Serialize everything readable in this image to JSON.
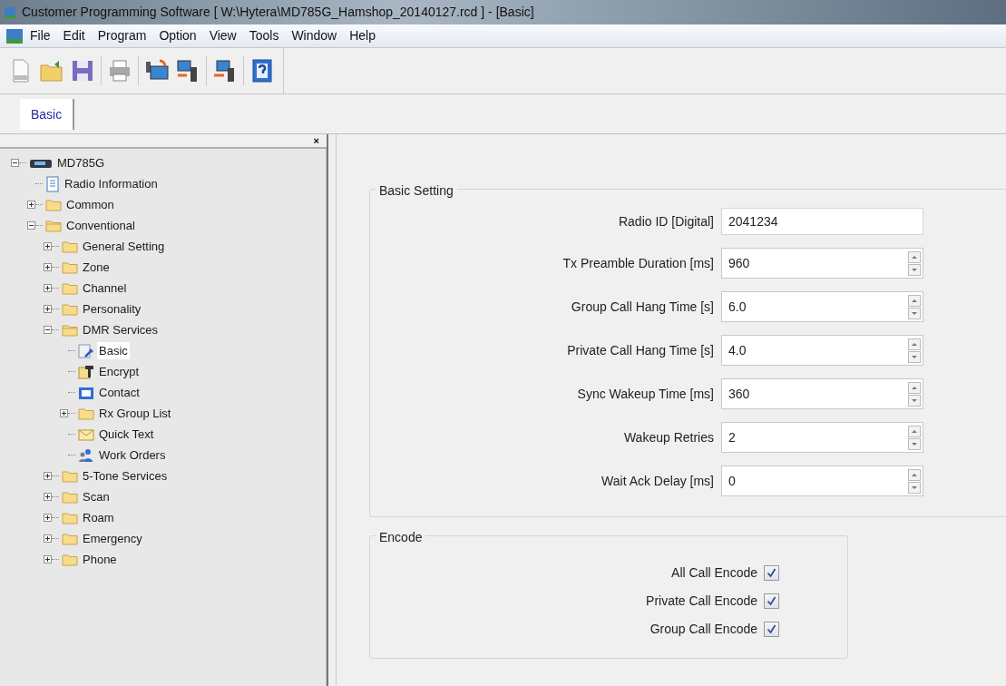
{
  "window": {
    "title": "Customer Programming Software [ W:\\Hytera\\MD785G_Hamshop_20140127.rcd ] - [Basic]"
  },
  "menu": [
    "File",
    "Edit",
    "Program",
    "Option",
    "View",
    "Tools",
    "Window",
    "Help"
  ],
  "tabs": [
    {
      "label": "Basic",
      "selected": true
    }
  ],
  "tree_pane": {
    "close": "×"
  },
  "tree": [
    {
      "label": "MD785G",
      "kind": "device",
      "expanded": true,
      "children": [
        {
          "label": "Radio Information",
          "kind": "document"
        },
        {
          "label": "Common",
          "kind": "folder",
          "expanded": false
        },
        {
          "label": "Conventional",
          "kind": "folder",
          "expanded": true,
          "children": [
            {
              "label": "General Setting",
              "kind": "folder",
              "expanded": false
            },
            {
              "label": "Zone",
              "kind": "folder",
              "expanded": false
            },
            {
              "label": "Channel",
              "kind": "folder",
              "expanded": false
            },
            {
              "label": "Personality",
              "kind": "folder",
              "expanded": false
            },
            {
              "label": "DMR Services",
              "kind": "folder",
              "expanded": true,
              "children": [
                {
                  "label": "Basic",
                  "kind": "settings",
                  "selected": true
                },
                {
                  "label": "Encrypt",
                  "kind": "key",
                  "selected": false
                },
                {
                  "label": "Contact",
                  "kind": "contact",
                  "selected": false
                },
                {
                  "label": "Rx Group List",
                  "kind": "folder",
                  "expanded": false
                },
                {
                  "label": "Quick Text",
                  "kind": "mail",
                  "selected": false
                },
                {
                  "label": "Work Orders",
                  "kind": "people",
                  "selected": false
                }
              ]
            },
            {
              "label": "5-Tone Services",
              "kind": "folder",
              "expanded": false
            },
            {
              "label": "Scan",
              "kind": "folder",
              "expanded": false
            },
            {
              "label": "Roam",
              "kind": "folder",
              "expanded": false
            },
            {
              "label": "Emergency",
              "kind": "folder",
              "expanded": false
            },
            {
              "label": "Phone",
              "kind": "folder",
              "expanded": false
            }
          ]
        }
      ]
    }
  ],
  "basic_setting": {
    "title": "Basic Setting",
    "fields": [
      {
        "label": "Radio ID [Digital]",
        "value": "2041234",
        "kind": "text"
      },
      {
        "label": "Tx Preamble Duration [ms]",
        "value": "960",
        "kind": "spin"
      },
      {
        "label": "Group Call Hang Time [s]",
        "value": "6.0",
        "kind": "spin"
      },
      {
        "label": "Private Call Hang Time [s]",
        "value": "4.0",
        "kind": "spin"
      },
      {
        "label": "Sync Wakeup Time [ms]",
        "value": "360",
        "kind": "spin"
      },
      {
        "label": "Wakeup Retries",
        "value": "2",
        "kind": "spin"
      },
      {
        "label": "Wait Ack Delay [ms]",
        "value": "0",
        "kind": "spin"
      }
    ]
  },
  "encode": {
    "title": "Encode",
    "options": [
      {
        "label": "All Call Encode",
        "checked": true
      },
      {
        "label": "Private Call Encode",
        "checked": true
      },
      {
        "label": "Group Call Encode",
        "checked": true
      }
    ]
  }
}
